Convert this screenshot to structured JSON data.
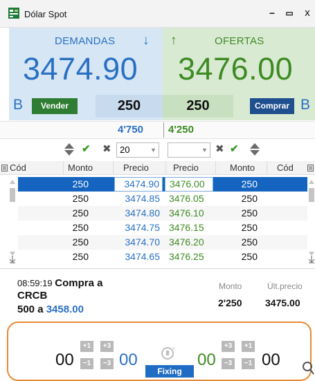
{
  "window": {
    "title": "Dólar Spot",
    "minimize_label": "−",
    "maximize_label": "▭",
    "close_label": "x"
  },
  "bid": {
    "label": "DEMANDAS",
    "arrow": "↓",
    "price": "3474.90",
    "letter": "B",
    "button": "Vender",
    "qty": "250",
    "total": "4'750",
    "color": "#2a70c2"
  },
  "ask": {
    "label": "OFERTAS",
    "arrow": "↑",
    "price": "3476.00",
    "letter": "B",
    "button": "Comprar",
    "qty": "250",
    "total": "4'250",
    "color": "#3e8a23"
  },
  "controls": {
    "bid_select_value": "20",
    "ask_select_value": ""
  },
  "table": {
    "headers": {
      "bid_cod": "Cód",
      "bid_monto": "Monto",
      "bid_precio": "Precio",
      "ask_precio": "Precio",
      "ask_monto": "Monto",
      "ask_cod": "Cód"
    },
    "rows": [
      {
        "bid_monto": "250",
        "bid_precio": "3474.90",
        "ask_precio": "3476.00",
        "ask_monto": "250"
      },
      {
        "bid_monto": "250",
        "bid_precio": "3474.85",
        "ask_precio": "3476.05",
        "ask_monto": "250"
      },
      {
        "bid_monto": "250",
        "bid_precio": "3474.80",
        "ask_precio": "3476.10",
        "ask_monto": "250"
      },
      {
        "bid_monto": "250",
        "bid_precio": "3474.75",
        "ask_precio": "3476.15",
        "ask_monto": "250"
      },
      {
        "bid_monto": "250",
        "bid_precio": "3474.70",
        "ask_precio": "3476.20",
        "ask_monto": "250"
      },
      {
        "bid_monto": "250",
        "bid_precio": "3474.65",
        "ask_precio": "3476.25",
        "ask_monto": "250"
      }
    ]
  },
  "last_trade": {
    "time": "08:59:19",
    "action": "Compra a",
    "counterparty": "CRCB",
    "qty_prefix": "500 a",
    "price": "3458.00",
    "monto_label": "Monto",
    "monto_value": "2'250",
    "last_price_label": "Últ.precio",
    "last_price_value": "3475.00"
  },
  "fixing": {
    "left_a": "00",
    "left_b": "00",
    "right_a": "00",
    "right_b": "00",
    "plus1": "+1",
    "plus3": "+3",
    "minus1": "−1",
    "minus3": "−3",
    "button": "Fixing"
  }
}
